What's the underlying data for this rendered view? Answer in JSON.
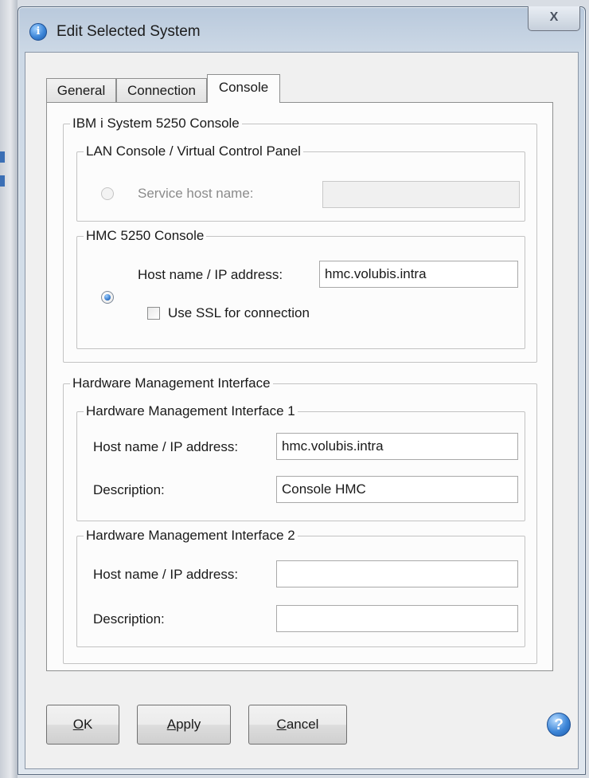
{
  "window": {
    "title": "Edit Selected System",
    "close_label": "X"
  },
  "tabs": [
    {
      "label": "General",
      "active": false
    },
    {
      "label": "Connection",
      "active": false
    },
    {
      "label": "Console",
      "active": true
    }
  ],
  "console_group": {
    "title": "IBM i System 5250 Console",
    "lan": {
      "title": "LAN Console / Virtual Control Panel",
      "service_host_label": "Service host name:",
      "service_host_value": "",
      "selected": false,
      "enabled": false
    },
    "hmc": {
      "title": "HMC 5250 Console",
      "host_label": "Host name / IP address:",
      "host_value": "hmc.volubis.intra",
      "selected": true,
      "ssl_label": "Use SSL for connection",
      "ssl_checked": false
    }
  },
  "hmi_group": {
    "title": "Hardware Management Interface",
    "interface1": {
      "title": "Hardware Management Interface 1",
      "host_label": "Host name / IP address:",
      "host_value": "hmc.volubis.intra",
      "description_label": "Description:",
      "description_value": "Console HMC"
    },
    "interface2": {
      "title": "Hardware Management Interface 2",
      "host_label": "Host name / IP address:",
      "host_value": "",
      "description_label": "Description:",
      "description_value": ""
    }
  },
  "buttons": {
    "ok": {
      "mnemonic": "O",
      "rest": "K"
    },
    "apply": {
      "mnemonic": "A",
      "rest": "pply"
    },
    "cancel": {
      "mnemonic": "C",
      "rest": "ancel"
    },
    "help_icon": "help-icon"
  },
  "colors": {
    "title_bar": "#c6d4e4",
    "dialog_bg": "#f0f0f0",
    "panel_bg": "#fcfcfc",
    "accent": "#2a6fc4"
  }
}
